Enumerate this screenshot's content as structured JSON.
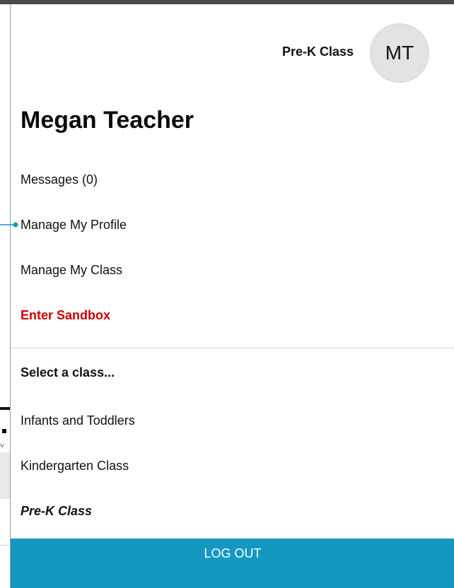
{
  "header": {
    "class_name": "Pre-K Class",
    "avatar_initials": "MT"
  },
  "user": {
    "name": "Megan Teacher"
  },
  "menu": {
    "messages": "Messages (0)",
    "manage_profile": "Manage My Profile",
    "manage_class": "Manage My Class",
    "sandbox": "Enter Sandbox"
  },
  "classes": {
    "heading": "Select a class...",
    "items": [
      "Infants and Toddlers",
      "Kindergarten Class",
      "Pre-K Class"
    ]
  },
  "actions": {
    "logout": "LOG OUT"
  },
  "background": {
    "snippet": "ev"
  },
  "colors": {
    "accent": "#1398c0",
    "sandbox": "#cc0000",
    "avatar_bg": "#e3e3e3"
  }
}
